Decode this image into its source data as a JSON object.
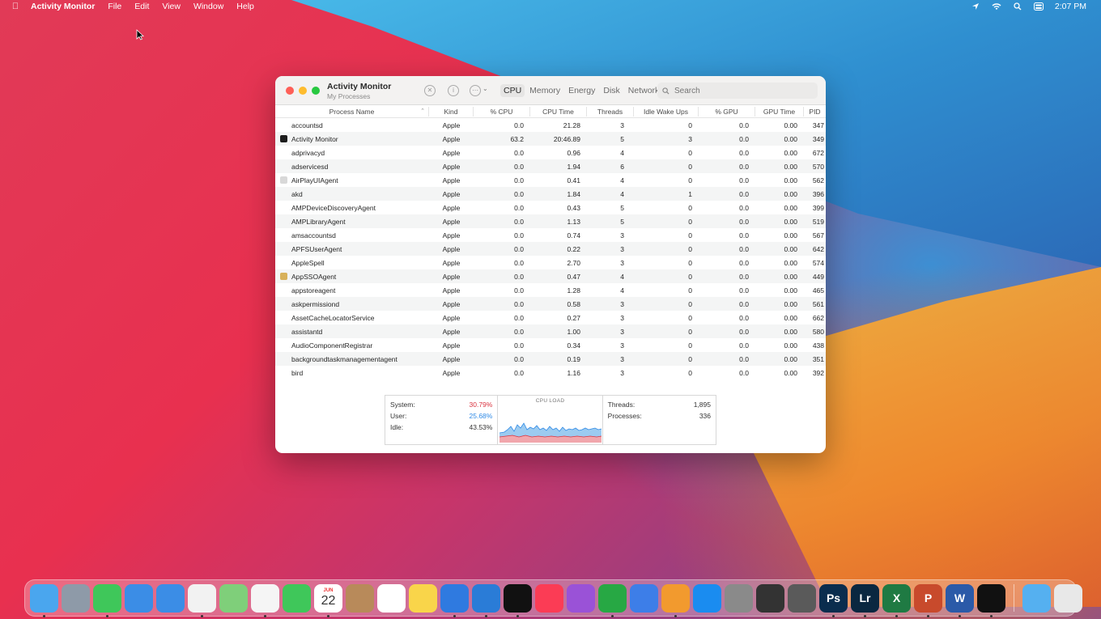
{
  "menubar": {
    "app_name": "Activity Monitor",
    "items": [
      "File",
      "Edit",
      "View",
      "Window",
      "Help"
    ],
    "clock": "2:07 PM"
  },
  "window": {
    "title": "Activity Monitor",
    "subtitle": "My Processes",
    "tabs": [
      "CPU",
      "Memory",
      "Energy",
      "Disk",
      "Network"
    ],
    "active_tab": "CPU",
    "search_placeholder": "Search"
  },
  "table": {
    "columns": [
      "Process Name",
      "Kind",
      "% CPU",
      "CPU Time",
      "Threads",
      "Idle Wake Ups",
      "% GPU",
      "GPU Time",
      "PID"
    ],
    "rows": [
      [
        "accountsd",
        "Apple",
        "0.0",
        "21.28",
        "3",
        "0",
        "0.0",
        "0.00",
        "347"
      ],
      [
        "Activity Monitor",
        "Apple",
        "63.2",
        "20:46.89",
        "5",
        "3",
        "0.0",
        "0.00",
        "349"
      ],
      [
        "adprivacyd",
        "Apple",
        "0.0",
        "0.96",
        "4",
        "0",
        "0.0",
        "0.00",
        "672"
      ],
      [
        "adservicesd",
        "Apple",
        "0.0",
        "1.94",
        "6",
        "0",
        "0.0",
        "0.00",
        "570"
      ],
      [
        "AirPlayUIAgent",
        "Apple",
        "0.0",
        "0.41",
        "4",
        "0",
        "0.0",
        "0.00",
        "562"
      ],
      [
        "akd",
        "Apple",
        "0.0",
        "1.84",
        "4",
        "1",
        "0.0",
        "0.00",
        "396"
      ],
      [
        "AMPDeviceDiscoveryAgent",
        "Apple",
        "0.0",
        "0.43",
        "5",
        "0",
        "0.0",
        "0.00",
        "399"
      ],
      [
        "AMPLibraryAgent",
        "Apple",
        "0.0",
        "1.13",
        "5",
        "0",
        "0.0",
        "0.00",
        "519"
      ],
      [
        "amsaccountsd",
        "Apple",
        "0.0",
        "0.74",
        "3",
        "0",
        "0.0",
        "0.00",
        "567"
      ],
      [
        "APFSUserAgent",
        "Apple",
        "0.0",
        "0.22",
        "3",
        "0",
        "0.0",
        "0.00",
        "642"
      ],
      [
        "AppleSpell",
        "Apple",
        "0.0",
        "2.70",
        "3",
        "0",
        "0.0",
        "0.00",
        "574"
      ],
      [
        "AppSSOAgent",
        "Apple",
        "0.0",
        "0.47",
        "4",
        "0",
        "0.0",
        "0.00",
        "449"
      ],
      [
        "appstoreagent",
        "Apple",
        "0.0",
        "1.28",
        "4",
        "0",
        "0.0",
        "0.00",
        "465"
      ],
      [
        "askpermissiond",
        "Apple",
        "0.0",
        "0.58",
        "3",
        "0",
        "0.0",
        "0.00",
        "561"
      ],
      [
        "AssetCacheLocatorService",
        "Apple",
        "0.0",
        "0.27",
        "3",
        "0",
        "0.0",
        "0.00",
        "662"
      ],
      [
        "assistantd",
        "Apple",
        "0.0",
        "1.00",
        "3",
        "0",
        "0.0",
        "0.00",
        "580"
      ],
      [
        "AudioComponentRegistrar",
        "Apple",
        "0.0",
        "0.34",
        "3",
        "0",
        "0.0",
        "0.00",
        "438"
      ],
      [
        "backgroundtaskmanagementagent",
        "Apple",
        "0.0",
        "0.19",
        "3",
        "0",
        "0.0",
        "0.00",
        "351"
      ],
      [
        "bird",
        "Apple",
        "0.0",
        "1.16",
        "3",
        "0",
        "0.0",
        "0.00",
        "392"
      ]
    ],
    "row_icons": [
      "",
      "activity-monitor",
      "",
      "",
      "airplay",
      "",
      "",
      "",
      "",
      "",
      "",
      "lock",
      "",
      "",
      "",
      "",
      "",
      "",
      ""
    ]
  },
  "cpu_panel": {
    "system_label": "System:",
    "system_value": "30.79%",
    "user_label": "User:",
    "user_value": "25.68%",
    "idle_label": "Idle:",
    "idle_value": "43.53%",
    "chart_title": "CPU LOAD",
    "threads_label": "Threads:",
    "threads_value": "1,895",
    "processes_label": "Processes:",
    "processes_value": "336",
    "colors": {
      "system": "#d9333f",
      "user": "#2f8ae6"
    }
  },
  "dock": {
    "calendar_month": "JUN",
    "calendar_day": "22",
    "apps": [
      "Finder",
      "Launchpad",
      "Messages",
      "Mail",
      "Safari",
      "News",
      "Maps",
      "Photos",
      "FaceTime",
      "Calendar",
      "Contacts",
      "Reminders",
      "Notes",
      "Xcode",
      "System Preferences Alt",
      "Apple TV",
      "Music",
      "Podcasts",
      "Numbers",
      "Keynote",
      "Pages",
      "App Store",
      "System Preferences",
      "Final Cut Pro",
      "Disk Utility",
      "Photoshop",
      "Lightroom",
      "Excel",
      "PowerPoint",
      "Word",
      "Activity Monitor",
      "Downloads",
      "Trash"
    ]
  }
}
